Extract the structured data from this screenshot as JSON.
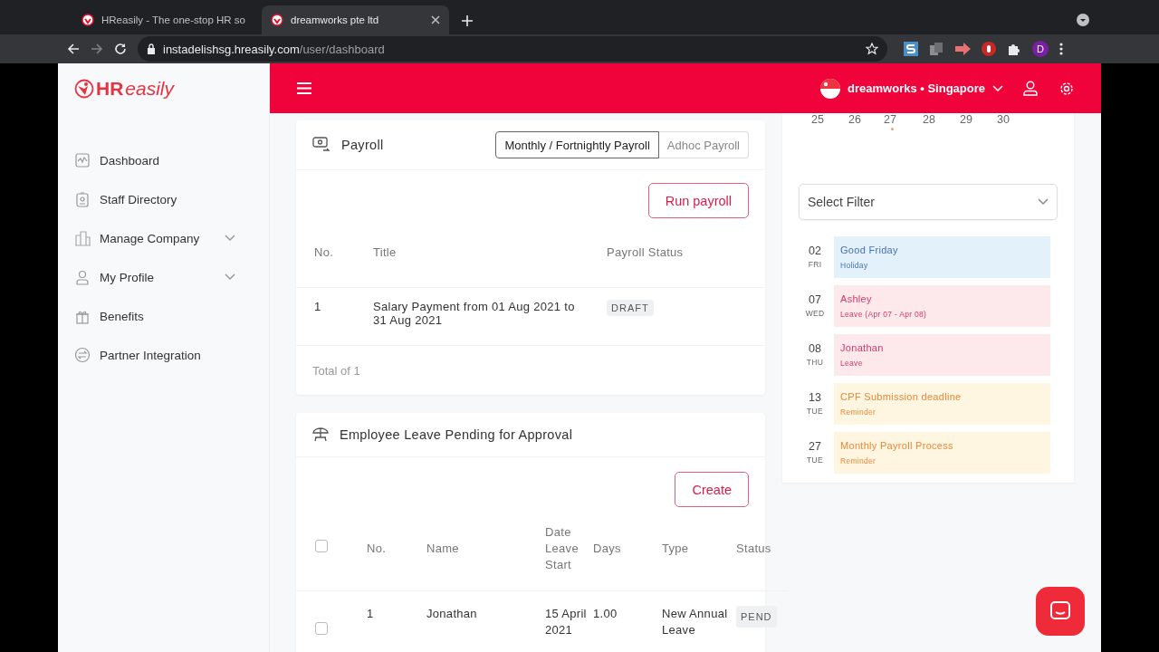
{
  "browser": {
    "tabs": [
      {
        "title": "HReasily - The one-stop HR so",
        "selected": false
      },
      {
        "title": "dreamworks pte ltd",
        "selected": true
      }
    ],
    "url_host": "instadelishsg.hreasily.com",
    "url_path": "/user/dashboard",
    "profile_initial": "D"
  },
  "logo": {
    "strong": "HR",
    "light": "easily"
  },
  "sidebar": {
    "items": [
      {
        "label": "Dashboard",
        "expandable": false
      },
      {
        "label": "Staff Directory",
        "expandable": false
      },
      {
        "label": "Manage Company",
        "expandable": true
      },
      {
        "label": "My Profile",
        "expandable": true
      },
      {
        "label": "Benefits",
        "expandable": false
      },
      {
        "label": "Partner Integration",
        "expandable": false
      }
    ]
  },
  "header": {
    "company": "dreamworks • Singapore"
  },
  "payroll": {
    "title": "Payroll",
    "tabs": [
      {
        "label": "Monthly / Fortnightly Payroll",
        "selected": true
      },
      {
        "label": "Adhoc Payroll",
        "selected": false
      }
    ],
    "action": "Run payroll",
    "columns": [
      "No.",
      "Title",
      "Payroll Status"
    ],
    "rows": [
      {
        "no": "1",
        "title": "Salary Payment from 01 Aug 2021 to 31 Aug 2021",
        "status": "DRAFT"
      }
    ],
    "footer": "Total of 1"
  },
  "leave": {
    "title": "Employee Leave Pending for Approval",
    "action": "Create",
    "all_checked": false,
    "columns": [
      "No.",
      "Name",
      "Date Leave Start",
      "Days",
      "Type",
      "Status"
    ],
    "rows": [
      {
        "checked": false,
        "no": "1",
        "name": "Jonathan",
        "start": "15 April 2021",
        "days": "1.00",
        "type": "New Annual Leave",
        "status": "PEND"
      }
    ]
  },
  "calendar": {
    "days": [
      {
        "label": "25",
        "has_event": false
      },
      {
        "label": "26",
        "has_event": false
      },
      {
        "label": "27",
        "has_event": true
      },
      {
        "label": "28",
        "has_event": false
      },
      {
        "label": "29",
        "has_event": false
      },
      {
        "label": "30",
        "has_event": false
      }
    ],
    "filter_placeholder": "Select Filter",
    "events": [
      {
        "day": "02",
        "weekday": "FRI",
        "title": "Good Friday",
        "subtitle": "Holiday",
        "kind": "holiday"
      },
      {
        "day": "07",
        "weekday": "WED",
        "title": "Ashley",
        "subtitle": "Leave (Apr 07 - Apr 08)",
        "kind": "leave"
      },
      {
        "day": "08",
        "weekday": "THU",
        "title": "Jonathan",
        "subtitle": "Leave",
        "kind": "leave"
      },
      {
        "day": "13",
        "weekday": "TUE",
        "title": "CPF Submission deadline",
        "subtitle": "Reminder",
        "kind": "reminder"
      },
      {
        "day": "27",
        "weekday": "TUE",
        "title": "Monthly Payroll Process",
        "subtitle": "Reminder",
        "kind": "reminder"
      }
    ]
  }
}
